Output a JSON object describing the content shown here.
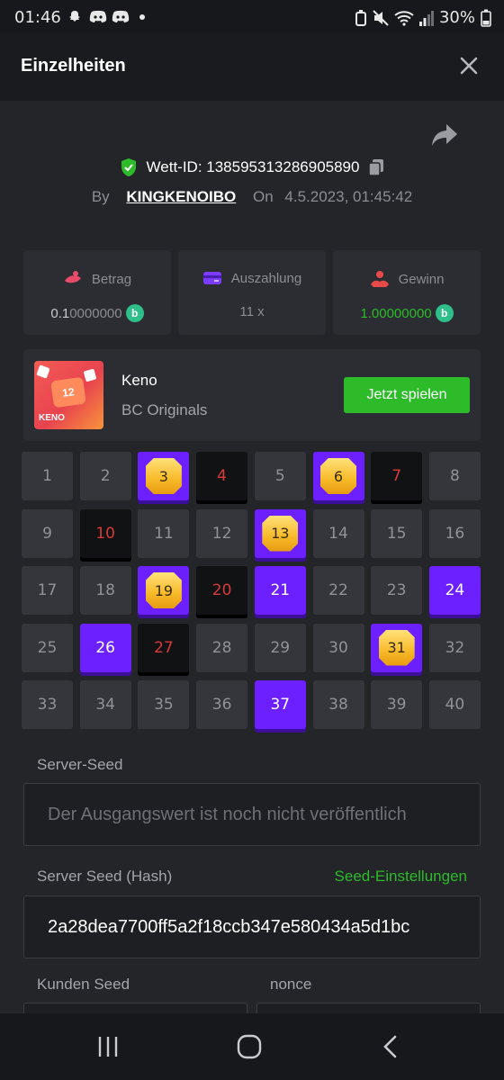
{
  "status_bar": {
    "time": "01:46",
    "battery": "30%"
  },
  "header": {
    "title": "Einzelheiten"
  },
  "bet": {
    "id_label": "Wett-ID: 138595313286905890",
    "by_label": "By",
    "username": "KINGKENOIBO",
    "on_label": "On",
    "date": "4.5.2023, 01:45:42"
  },
  "stats": [
    {
      "label": "Betrag",
      "value": "0.10000000",
      "value_lead": "0.1",
      "value_rest": "0000000",
      "icon": "bet-icon",
      "icon_color": "#e84a6a"
    },
    {
      "label": "Auszahlung",
      "value": "11 x",
      "icon": "wallet-icon",
      "icon_color": "#7b3cff"
    },
    {
      "label": "Gewinn",
      "value": "1.00000000",
      "value_lead": "1",
      "value_rest": ".00000000",
      "icon": "win-icon",
      "icon_color": "#e84a4a"
    }
  ],
  "game": {
    "name": "Keno",
    "provider": "BC Originals",
    "play_label": "Jetzt spielen",
    "thumb_number": "12",
    "thumb_label": "KENO"
  },
  "keno": {
    "numbers": [
      "1",
      "2",
      "3",
      "4",
      "5",
      "6",
      "7",
      "8",
      "9",
      "10",
      "11",
      "12",
      "13",
      "14",
      "15",
      "16",
      "17",
      "18",
      "19",
      "20",
      "21",
      "22",
      "23",
      "24",
      "25",
      "26",
      "27",
      "28",
      "29",
      "30",
      "31",
      "32",
      "33",
      "34",
      "35",
      "36",
      "37",
      "38",
      "39",
      "40"
    ],
    "hits": [
      3,
      6,
      13,
      19,
      31
    ],
    "selected_only": [
      21,
      24,
      26,
      37
    ],
    "drawn_misses": [
      4,
      7,
      10,
      20,
      27
    ]
  },
  "seeds": {
    "server_seed_label": "Server-Seed",
    "server_seed_value": "Der Ausgangswert ist noch nicht veröffentlich",
    "hash_label": "Server Seed (Hash)",
    "settings_link": "Seed-Einstellungen",
    "hash_value": "2a28dea7700ff5a2f18ccb347e580434a5d1bc",
    "client_seed_label": "Kunden Seed",
    "nonce_label": "nonce"
  },
  "colors": {
    "accent_green": "#2dbb2a",
    "selected_purple": "#6c1fff",
    "miss_red": "#d83a3a",
    "coin_teal": "#2fbf8a"
  }
}
